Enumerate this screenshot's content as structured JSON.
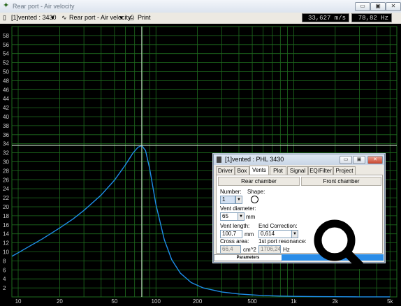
{
  "window": {
    "title": "Rear port - Air velocity",
    "controls": [
      "▭",
      "▣",
      "✕"
    ]
  },
  "toolbar": {
    "project_select": "[1]vented : 3430",
    "graph_select": "Rear port - Air velocity",
    "print_label": "Print",
    "peak_readout": "33,627 m/s peak",
    "freq_readout": "78,82 Hz"
  },
  "dialog": {
    "title": "[1]vented : PHL 3430",
    "tabs": [
      "Driver",
      "Box",
      "Vents",
      "Plot",
      "Signal",
      "EQ/Filter",
      "Project"
    ],
    "active_tab": "Vents",
    "rear_chamber": "Rear chamber",
    "front_chamber": "Front chamber",
    "number_label": "Number:",
    "number_value": "1",
    "shape_label": "Shape:",
    "vent_diameter_label": "Vent diameter:",
    "vent_diameter_value": "65",
    "vent_diameter_unit": "mm",
    "vent_length_label": "Vent length:",
    "vent_length_value": "100,7",
    "vent_length_unit": "mm",
    "end_correction_label": "End Correction:",
    "end_correction_value": "0,614",
    "cross_area_label": "Cross area:",
    "cross_area_value": "66,4",
    "cross_area_unit": "cm^2",
    "port_resonance_label": "1st port resonance:",
    "port_resonance_value": "1706,24",
    "port_resonance_unit": "Hz",
    "parameters_label": "Parameters"
  },
  "chart_data": {
    "type": "line",
    "x_scale": "log",
    "xlim": [
      9,
      5600
    ],
    "ylim": [
      0,
      60
    ],
    "x_ticks": [
      10,
      20,
      50,
      100,
      200,
      500,
      1000,
      2000,
      5000
    ],
    "x_tick_labels": [
      "10",
      "20",
      "50",
      "100",
      "200",
      "500",
      "1k",
      "2k",
      "5k"
    ],
    "y_ticks": [
      2,
      4,
      6,
      8,
      10,
      12,
      14,
      16,
      18,
      20,
      22,
      24,
      26,
      28,
      30,
      32,
      34,
      36,
      38,
      40,
      42,
      44,
      46,
      48,
      50,
      52,
      54,
      56,
      58
    ],
    "grid": true,
    "cursor_x": 78.82,
    "cursor_y": 33.627,
    "series": [
      {
        "color": "#1e8ee8",
        "x": [
          9,
          10,
          12,
          15,
          20,
          25,
          30,
          40,
          50,
          60,
          68,
          74,
          78.82,
          84,
          90,
          100,
          115,
          130,
          150,
          180,
          220,
          300,
          400,
          600,
          800,
          1000,
          1500,
          2000,
          3000,
          5000
        ],
        "y": [
          9.0,
          9.8,
          11.2,
          12.9,
          15.3,
          17.3,
          19.2,
          22.6,
          25.9,
          29.3,
          31.9,
          33.2,
          33.6,
          32.5,
          28.5,
          20.5,
          12.7,
          8.3,
          5.3,
          3.2,
          2.0,
          1.1,
          0.65,
          0.3,
          0.18,
          0.12,
          0.06,
          0.04,
          0.02,
          0.01
        ]
      }
    ]
  }
}
